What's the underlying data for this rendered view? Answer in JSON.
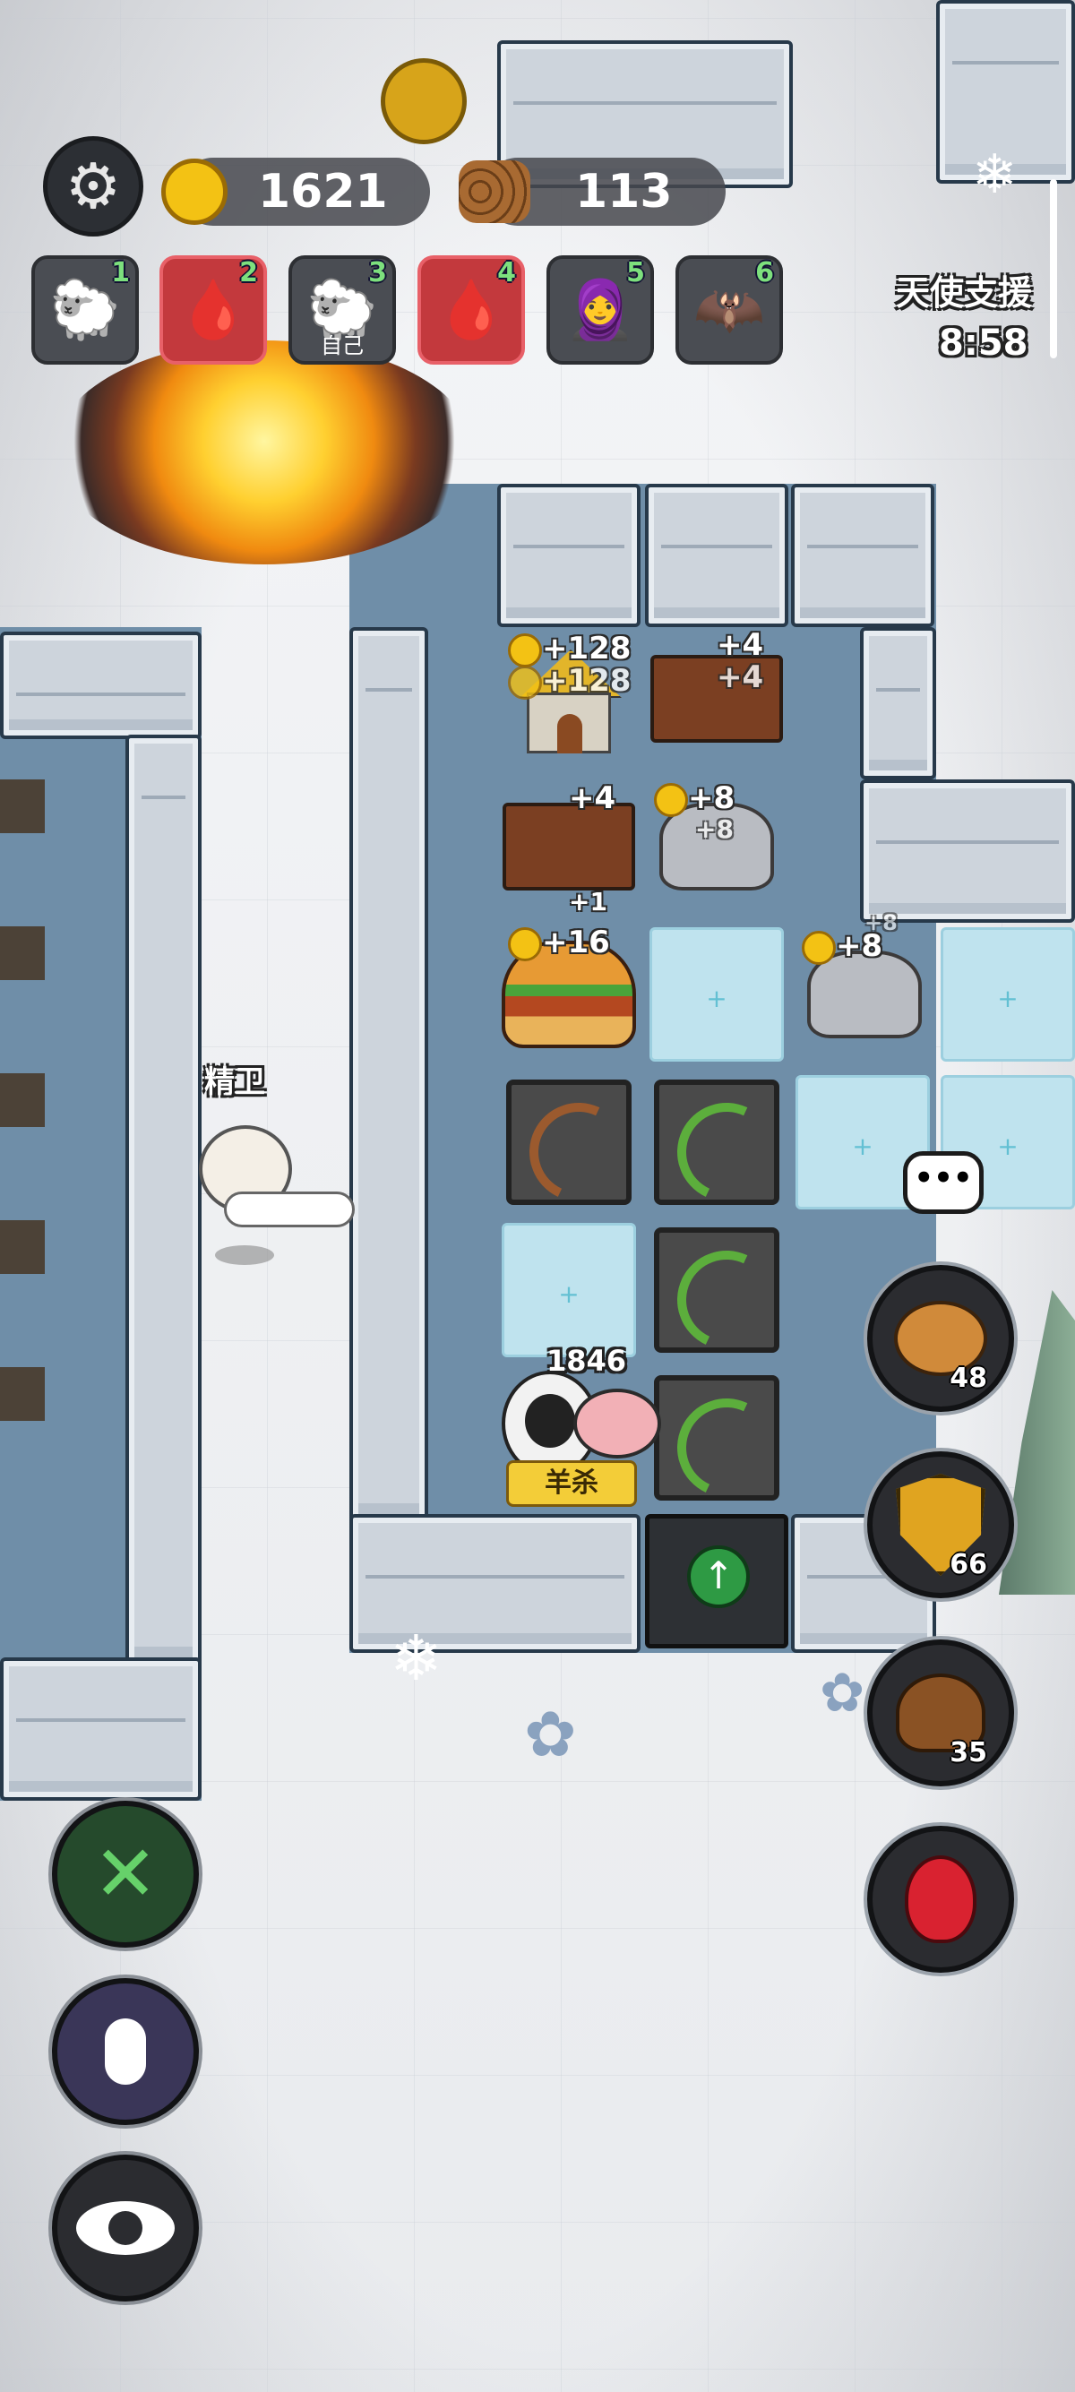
{
  "resources": {
    "gold": "1621",
    "wood": "113"
  },
  "players": [
    {
      "num": "1",
      "face": "🐑",
      "enemy": false,
      "tag": ""
    },
    {
      "num": "2",
      "face": "🩸",
      "enemy": true,
      "tag": ""
    },
    {
      "num": "3",
      "face": "🐑",
      "enemy": false,
      "tag": "自己"
    },
    {
      "num": "4",
      "face": "🩸",
      "enemy": true,
      "tag": ""
    },
    {
      "num": "5",
      "face": "🧕",
      "enemy": false,
      "tag": ""
    },
    {
      "num": "6",
      "face": "🦇",
      "enemy": false,
      "tag": ""
    }
  ],
  "event": {
    "title": "天使支援",
    "timer": "8:58"
  },
  "yields": {
    "house_gold": "+128",
    "house_gold2": "+128",
    "lumber1": "+4",
    "lumber1b": "+4",
    "quarry1": "+8",
    "quarry1b": "+8",
    "lumber2": "+4",
    "lumber2b": "+1",
    "burger": "+16",
    "quarry2": "+8",
    "quarry2b": "+8"
  },
  "character_name": "精卫",
  "player_unit": {
    "hp": "1846",
    "action": "羊杀"
  },
  "side_buttons": {
    "piggy_bank": "48",
    "shield": "66",
    "poop": "35"
  },
  "icons": {
    "settings": "gear-icon",
    "build": "tools-icon",
    "voice": "microphone-icon",
    "view": "eye-icon",
    "chat": "chat-bubble-icon",
    "potion": "potion-icon"
  },
  "colors": {
    "enemy_slot": "#c3393d",
    "coin": "#f3c214",
    "ice_cell": "#bfe3ee",
    "upgrade_arrow": "#2e9a44"
  }
}
